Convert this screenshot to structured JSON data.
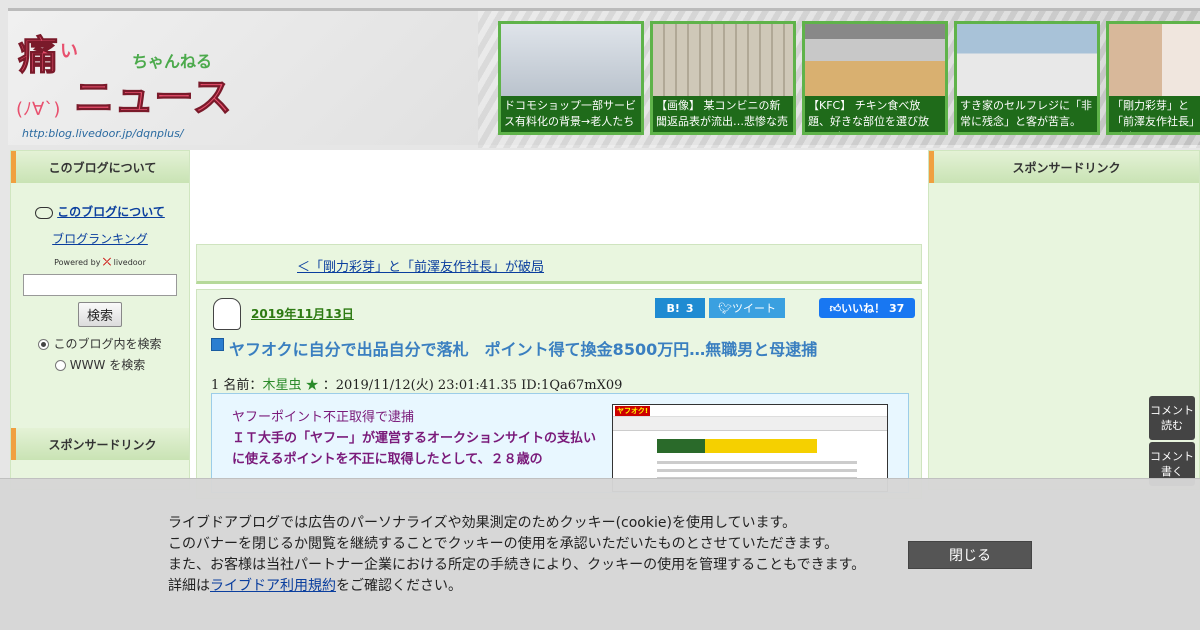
{
  "header": {
    "logo_title": "痛いニュース",
    "logo_sub": "ちゃんねる",
    "logo_face": "(ﾉ∀`)",
    "logo_url": "http:blog.livedoor.jp/dqnplus/",
    "thumbnails": [
      {
        "caption": "ドコモショップ一部サービス有料化の背景→老人たち"
      },
      {
        "caption": "【画像】 某コンビニの新聞返品表が流出…悲惨な売り"
      },
      {
        "caption": "【KFC】 チキン食べ放題、好きな部位を選び放題！ブ"
      },
      {
        "caption": "すき家のセルフレジに「非常に残念」と客が苦言。"
      },
      {
        "caption": "「剛力彩芽」と「前澤友作社長」が破局"
      }
    ]
  },
  "left": {
    "about_title": "このブログについて",
    "about_link": "このブログについて",
    "ranking_link": "ブログランキング",
    "powered_prefix": "Powered by",
    "powered_brand": "livedoor",
    "search_button": "検索",
    "radio_blog": "このブログ内を検索",
    "radio_www": "WWW を検索",
    "sponsor_title": "スポンサードリンク"
  },
  "right": {
    "sponsor_title": "スポンサードリンク",
    "btn_comment_read": "コメント読む",
    "btn_comment_write": "コメント書く"
  },
  "article": {
    "prev_link": "＜「剛力彩芽」と「前澤友作社長」が破局",
    "date": "2019年11月13日",
    "hatena_label": "B!",
    "hatena_count": "3",
    "tweet_label": "ツイート",
    "like_label": "いいね！",
    "like_count": "37",
    "title": "ヤフオクに自分で出品自分で落札　ポイント得て換金8500万円…無職男と母逮捕",
    "comment_num": "1",
    "comment_label": "名前：",
    "comment_name": "木星虫 ★",
    "comment_meta": "：2019/11/12(火) 23:01:41.35 ID:1Qa67mX09",
    "quote_sub": "ヤフーポイント不正取得で逮捕",
    "quote_main": "ＩＴ大手の「ヤフー」が運営するオークションサイトの支払いに使えるポイントを不正に取得したとして、２８歳の",
    "shot_logo": "ヤフオク!"
  },
  "cookie": {
    "line1": "ライブドアブログでは広告のパーソナライズや効果測定のためクッキー(cookie)を使用しています。",
    "line2": "このバナーを閉じるか閲覧を継続することでクッキーの使用を承認いただいたものとさせていただきます。",
    "line3": "また、お客様は当社パートナー企業における所定の手続きにより、クッキーの使用を管理することもできます。",
    "line4_prefix": "詳細は",
    "line4_link": "ライブドア利用規約",
    "line4_suffix": "をご確認ください。",
    "close_label": "閉じる"
  }
}
